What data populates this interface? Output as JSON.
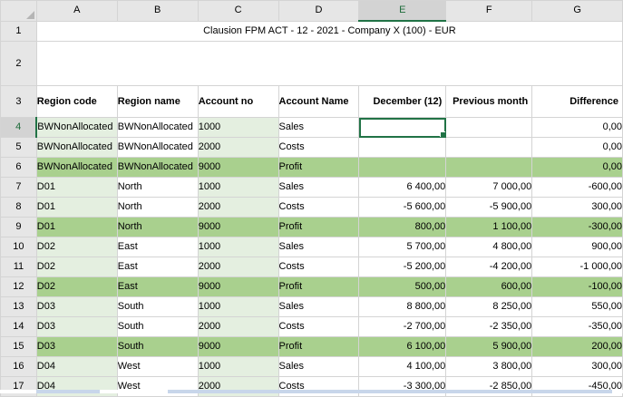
{
  "columns": [
    "A",
    "B",
    "C",
    "D",
    "E",
    "F",
    "G"
  ],
  "title": "Clausion FPM     ACT - 12 - 2021 - Company X (100) - EUR",
  "headers": {
    "region_code": "Region code",
    "region_name": "Region name",
    "account_no": "Account no",
    "account_name": "Account Name",
    "december": "December (12)",
    "previous": "Previous month",
    "difference": "Difference"
  },
  "row_numbers": [
    "1",
    "2",
    "3",
    "4",
    "5",
    "6",
    "7",
    "8",
    "9",
    "10",
    "11",
    "12",
    "13",
    "14",
    "15",
    "16",
    "17"
  ],
  "rows": [
    {
      "code": "BWNonAllocated",
      "name": "BWNonAllocated",
      "acct": "1000",
      "acct_name": "Sales",
      "dec": "",
      "prev": "",
      "diff": "0,00"
    },
    {
      "code": "BWNonAllocated",
      "name": "BWNonAllocated",
      "acct": "2000",
      "acct_name": "Costs",
      "dec": "",
      "prev": "",
      "diff": "0,00"
    },
    {
      "code": "BWNonAllocated",
      "name": "BWNonAllocated",
      "acct": "9000",
      "acct_name": "Profit",
      "dec": "",
      "prev": "",
      "diff": "0,00"
    },
    {
      "code": "D01",
      "name": "North",
      "acct": "1000",
      "acct_name": "Sales",
      "dec": "6 400,00",
      "prev": "7 000,00",
      "diff": "-600,00"
    },
    {
      "code": "D01",
      "name": "North",
      "acct": "2000",
      "acct_name": "Costs",
      "dec": "-5 600,00",
      "prev": "-5 900,00",
      "diff": "300,00"
    },
    {
      "code": "D01",
      "name": "North",
      "acct": "9000",
      "acct_name": "Profit",
      "dec": "800,00",
      "prev": "1 100,00",
      "diff": "-300,00"
    },
    {
      "code": "D02",
      "name": "East",
      "acct": "1000",
      "acct_name": "Sales",
      "dec": "5 700,00",
      "prev": "4 800,00",
      "diff": "900,00"
    },
    {
      "code": "D02",
      "name": "East",
      "acct": "2000",
      "acct_name": "Costs",
      "dec": "-5 200,00",
      "prev": "-4 200,00",
      "diff": "-1 000,00"
    },
    {
      "code": "D02",
      "name": "East",
      "acct": "9000",
      "acct_name": "Profit",
      "dec": "500,00",
      "prev": "600,00",
      "diff": "-100,00"
    },
    {
      "code": "D03",
      "name": "South",
      "acct": "1000",
      "acct_name": "Sales",
      "dec": "8 800,00",
      "prev": "8 250,00",
      "diff": "550,00"
    },
    {
      "code": "D03",
      "name": "South",
      "acct": "2000",
      "acct_name": "Costs",
      "dec": "-2 700,00",
      "prev": "-2 350,00",
      "diff": "-350,00"
    },
    {
      "code": "D03",
      "name": "South",
      "acct": "9000",
      "acct_name": "Profit",
      "dec": "6 100,00",
      "prev": "5 900,00",
      "diff": "200,00"
    },
    {
      "code": "D04",
      "name": "West",
      "acct": "1000",
      "acct_name": "Sales",
      "dec": "4 100,00",
      "prev": "3 800,00",
      "diff": "300,00"
    },
    {
      "code": "D04",
      "name": "West",
      "acct": "2000",
      "acct_name": "Costs",
      "dec": "-3 300,00",
      "prev": "-2 850,00",
      "diff": "-450,00"
    }
  ],
  "colors": {
    "profit_row": "#a9d08e",
    "key_column_fill": "#e4efe0",
    "selection": "#217346"
  }
}
